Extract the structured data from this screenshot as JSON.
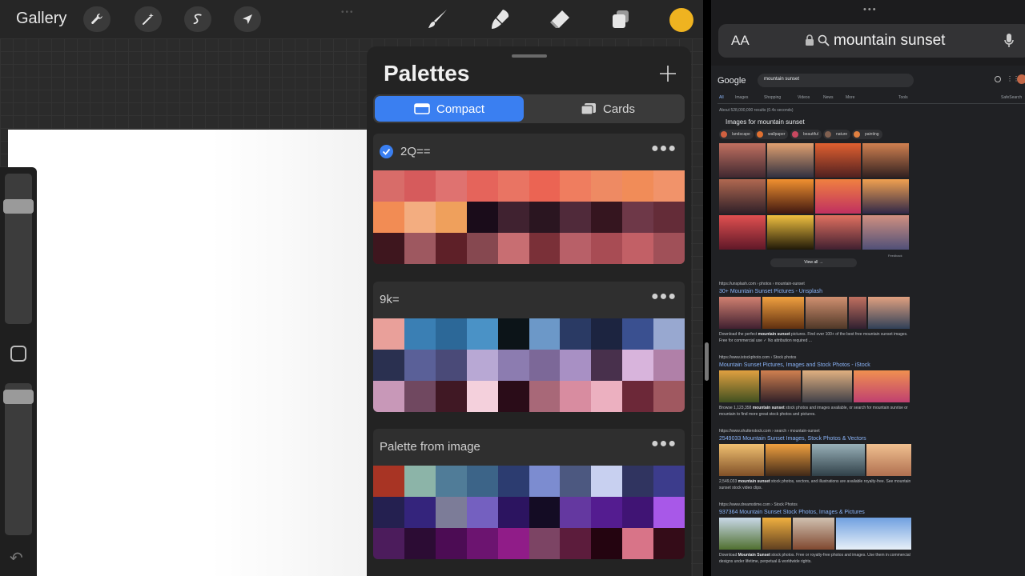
{
  "procreate": {
    "gallery_label": "Gallery",
    "toolbar_left_icons": [
      "wrench-icon",
      "magic-wand-icon",
      "selection-s-icon",
      "arrow-cursor-icon"
    ],
    "toolbar_right_icons": [
      "brush-icon",
      "smudge-icon",
      "eraser-icon",
      "layers-icon"
    ],
    "current_color": "#efb320",
    "palettes_panel": {
      "title": "Palettes",
      "add_icon": "plus-icon",
      "view_modes": [
        {
          "label": "Compact",
          "active": true
        },
        {
          "label": "Cards",
          "active": false
        }
      ],
      "palettes": [
        {
          "name": "2Q==",
          "default": true,
          "swatches": [
            "#d86c69",
            "#d65b5c",
            "#df7270",
            "#e5645b",
            "#e97463",
            "#eb6453",
            "#ef7d5f",
            "#ee8a63",
            "#f18c58",
            "#f1936a",
            "#f28c54",
            "#f3ad80",
            "#efa05c",
            "#1a0c1a",
            "#402230",
            "#2a1520",
            "#502a3a",
            "#35151f",
            "#6e3848",
            "#642c38",
            "#3e161e",
            "#9e5860",
            "#5e2028",
            "#864850",
            "#c86e72",
            "#7a3038",
            "#b86068",
            "#a84c54",
            "#c26066",
            "#a05058"
          ]
        },
        {
          "name": "9k=",
          "default": false,
          "swatches": [
            "#e9a09a",
            "#3a7fb4",
            "#2c6898",
            "#4a92c6",
            "#0c1418",
            "#6c98c8",
            "#2a3a64",
            "#1c2440",
            "#3a5090",
            "#98a8d0",
            "#2a3050",
            "#5a6098",
            "#4a4a78",
            "#b8a8d4",
            "#8c7cb0",
            "#7c6898",
            "#a890c4",
            "#48304c",
            "#d8b4dc",
            "#b080a8",
            "#c898b8",
            "#704860",
            "#401824",
            "#f4d0dc",
            "#2a0c18",
            "#a86878",
            "#d88ca0",
            "#ecb0c0",
            "#6c2838",
            "#a05860"
          ]
        },
        {
          "name": "Palette from image",
          "default": false,
          "swatches": [
            "#a83424",
            "#8cb4a8",
            "#507c98",
            "#3c6488",
            "#2c3c70",
            "#7c8cd0",
            "#4c5880",
            "#c8d0f0",
            "#303460",
            "#3c3c8c",
            "#242050",
            "#34247c",
            "#7c7c98",
            "#7460c0",
            "#2c1460",
            "#140c24",
            "#6438a0",
            "#541c90",
            "#401474",
            "#a858e8",
            "#4c1c5c",
            "#2c0c34",
            "#4c0c54",
            "#6c1470",
            "#901c88",
            "#7c4464",
            "#5c1c3c",
            "#240410",
            "#d87488",
            "#340c18"
          ]
        }
      ]
    }
  },
  "safari": {
    "text_size_label": "AA",
    "address_query": "mountain sunset",
    "google": {
      "logo": "Google",
      "search_value": "mountain sunset",
      "tabs": [
        "All",
        "Images",
        "Shopping",
        "Videos",
        "News",
        "More",
        "Tools"
      ],
      "safesearch": "SafeSearch",
      "result_count": "About 528,000,000 results (0.4s seconds)",
      "images_heading": "Images for mountain sunset",
      "chips": [
        "landscape",
        "wallpaper",
        "beautiful",
        "nature",
        "painting"
      ],
      "feedback": "Feedback",
      "view_all": "View all",
      "results": [
        {
          "url": "https://unsplash.com › photos › mountain-sunset",
          "title": "30+ Mountain Sunset Pictures - Unsplash",
          "snippet_pre": "Download the perfect ",
          "snippet_bold": "mountain sunset",
          "snippet_post": " pictures. Find over 100+ of the best free mountain sunset images. Free for commercial use ✓ No attribution required ..."
        },
        {
          "url": "https://www.istockphoto.com › Stock photos",
          "title": "Mountain Sunset Pictures, Images and Stock Photos - iStock",
          "snippet_pre": "Browse 1,123,358 ",
          "snippet_bold": "mountain sunset",
          "snippet_post": " stock photos and images available, or search for mountain sunrise or mountain to find more great stock photos and pictures."
        },
        {
          "url": "https://www.shutterstock.com › search › mountain-sunset",
          "title": "2549033 Mountain Sunset Images, Stock Photos & Vectors",
          "snippet_pre": "2,549,033 ",
          "snippet_bold": "mountain sunset",
          "snippet_post": " stock photos, vectors, and illustrations are available royalty-free. See mountain sunset stock video clips."
        },
        {
          "url": "https://www.dreamstime.com › Stock Photos",
          "title": "937364 Mountain Sunset Stock Photos, Images & Pictures",
          "snippet_pre": "Download ",
          "snippet_bold": "Mountain Sunset",
          "snippet_post": " stock photos. Free or royalty-free photos and images. Use them in commercial designs under lifetime, perpetual & worldwide rights."
        }
      ]
    }
  }
}
